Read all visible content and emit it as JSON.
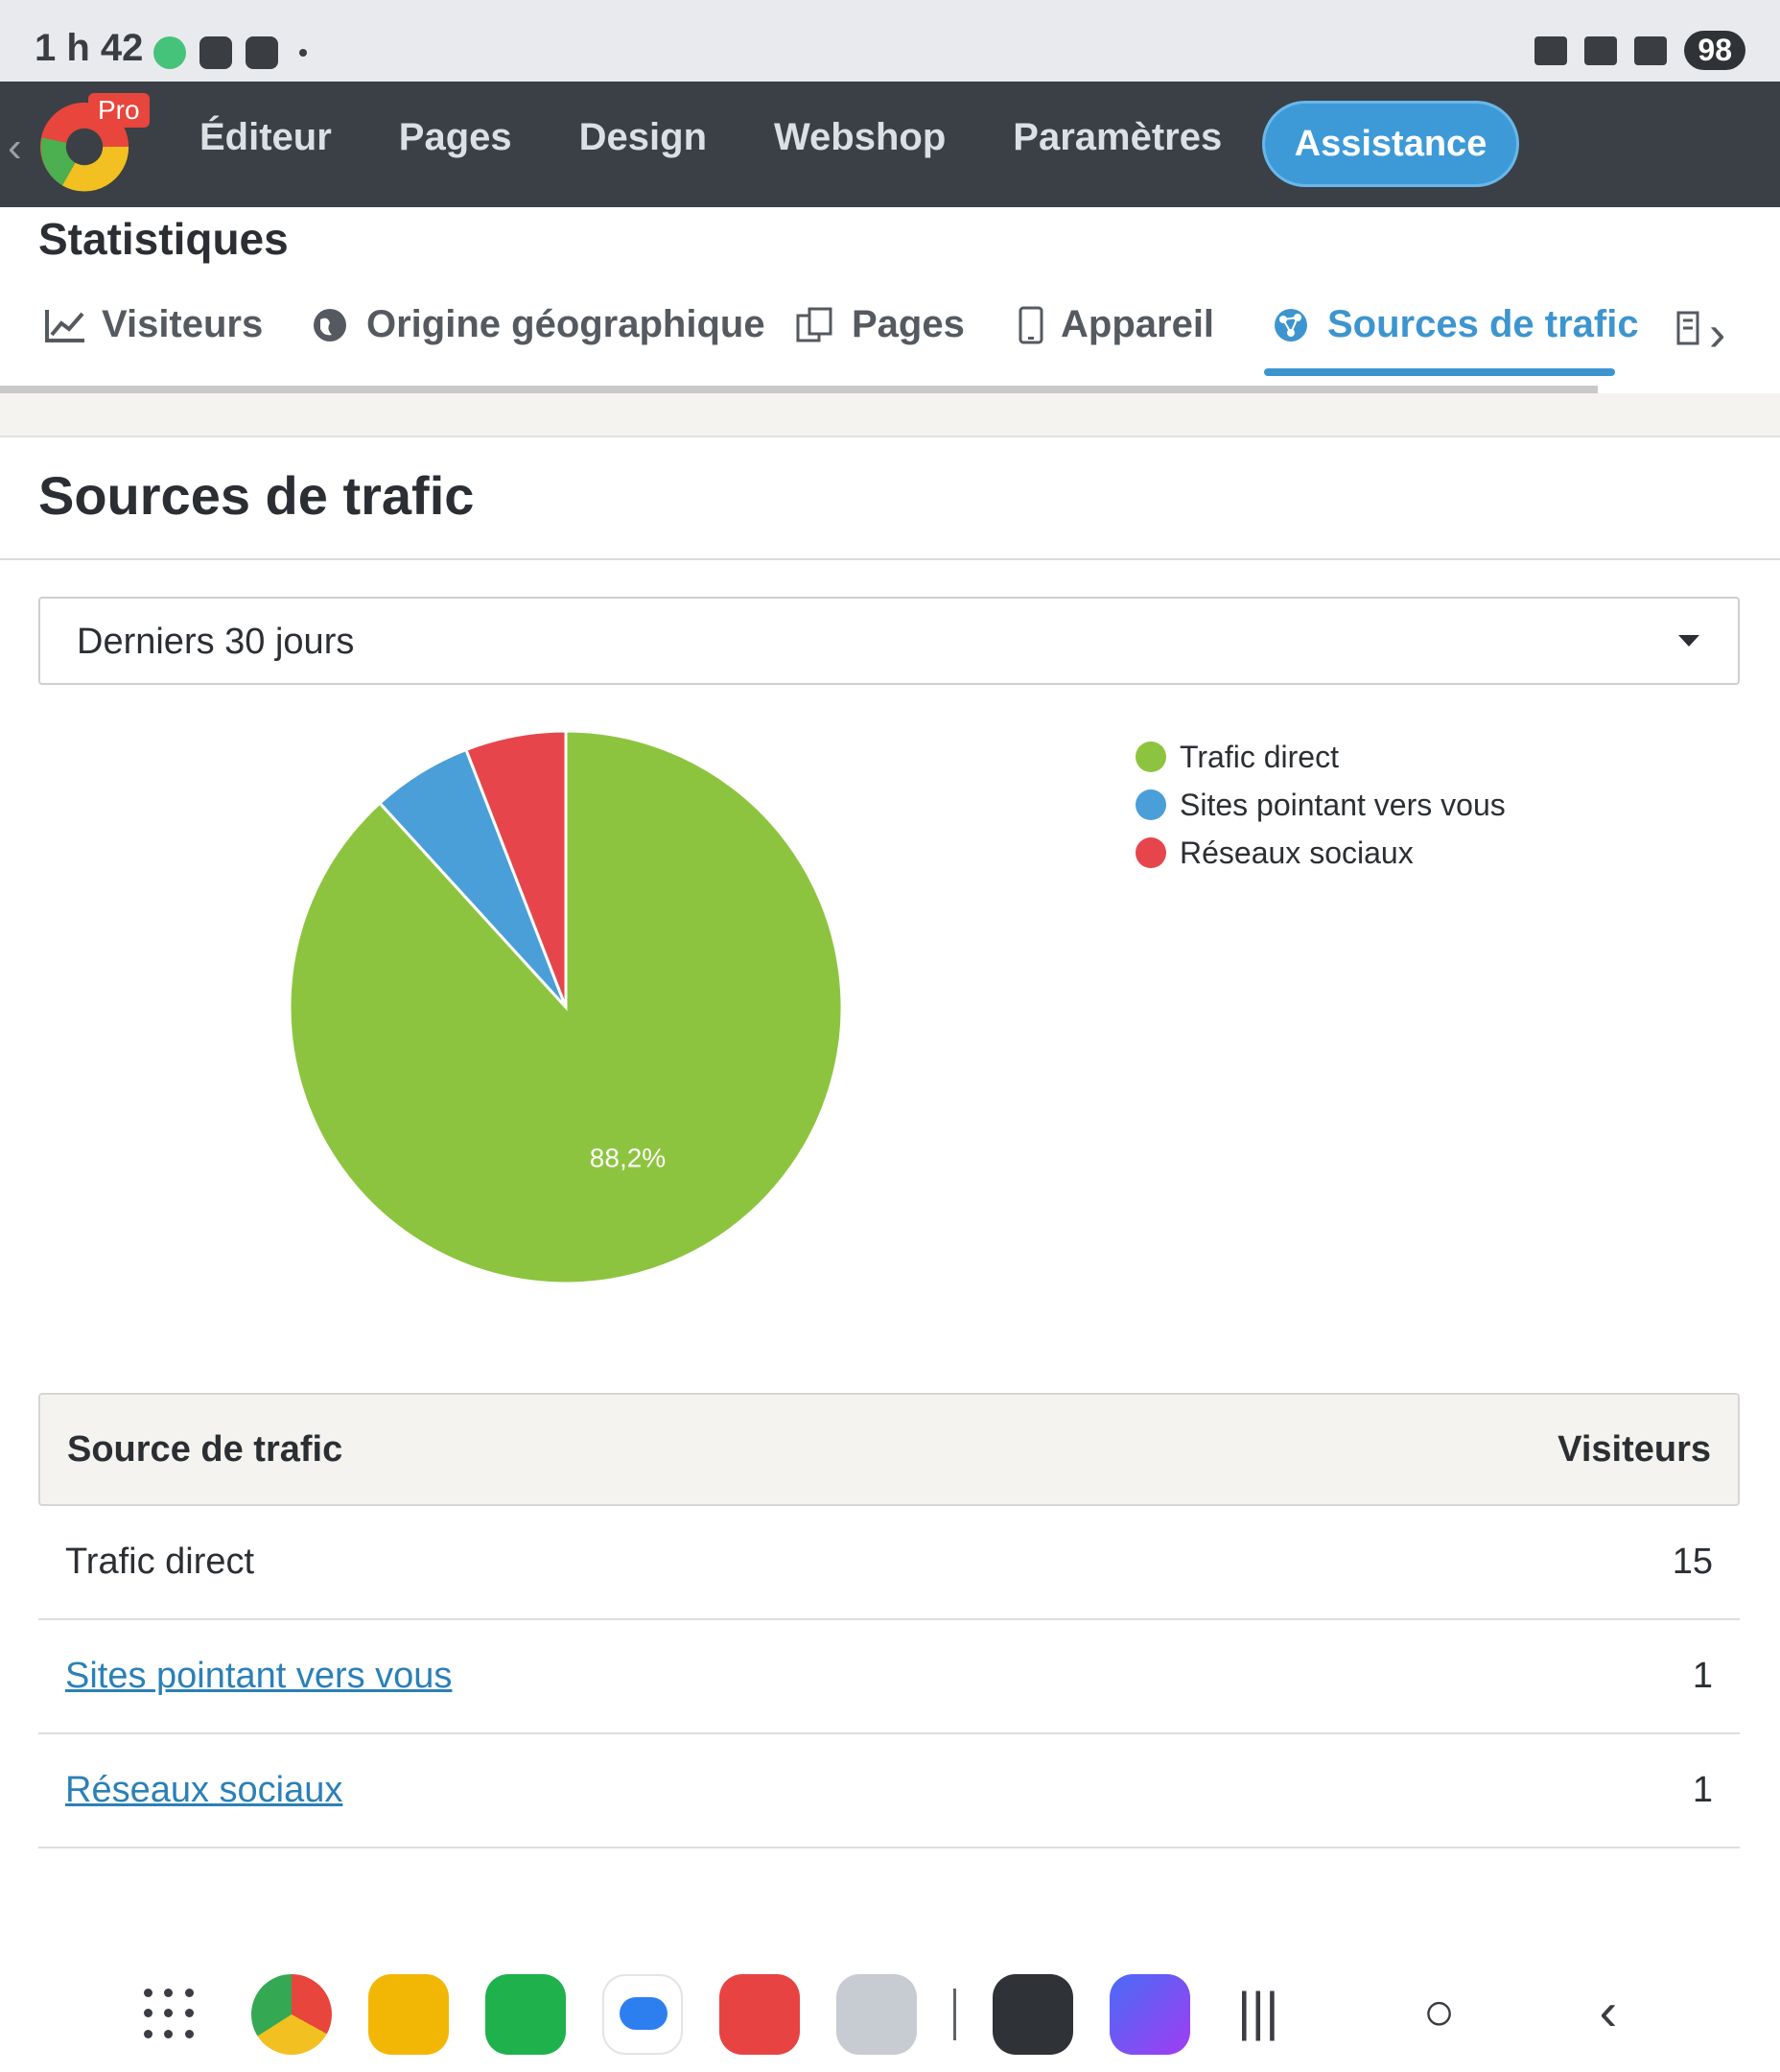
{
  "status_bar": {
    "time": "1 h 42",
    "battery": "98"
  },
  "nav": {
    "pro_badge": "Pro",
    "items": [
      "Éditeur",
      "Pages",
      "Design",
      "Webshop",
      "Paramètres"
    ],
    "assist": "Assistance"
  },
  "page_title": "Statistiques",
  "tabs": [
    {
      "label": "Visiteurs",
      "icon": "line-chart-icon"
    },
    {
      "label": "Origine géographique",
      "icon": "globe-icon"
    },
    {
      "label": "Pages",
      "icon": "pages-icon"
    },
    {
      "label": "Appareil",
      "icon": "phone-icon"
    },
    {
      "label": "Sources de trafic",
      "icon": "network-icon",
      "active": true
    }
  ],
  "section_title": "Sources de trafic",
  "period": {
    "selected": "Derniers 30 jours"
  },
  "chart_data": {
    "type": "pie",
    "labels": [
      "Trafic direct",
      "Sites pointant vers vous",
      "Réseaux sociaux"
    ],
    "values": [
      15,
      1,
      1
    ],
    "percent_labels": [
      "88,2%",
      "",
      ""
    ],
    "colors": [
      "#8dc43f",
      "#4a9fd8",
      "#e6464b"
    ],
    "legend": "top-right"
  },
  "table": {
    "headers": [
      "Source de trafic",
      "Visiteurs"
    ],
    "rows": [
      {
        "source": "Trafic direct",
        "visitors": "15",
        "link": false
      },
      {
        "source": "Sites pointant vers vous",
        "visitors": "1",
        "link": true
      },
      {
        "source": "Réseaux sociaux",
        "visitors": "1",
        "link": true
      }
    ]
  },
  "dock": {
    "apps": [
      "chrome-icon",
      "files-icon",
      "phone-call-icon",
      "messages-icon",
      "contacts-icon",
      "camera-icon",
      "settings-icon",
      "browser-icon"
    ]
  }
}
